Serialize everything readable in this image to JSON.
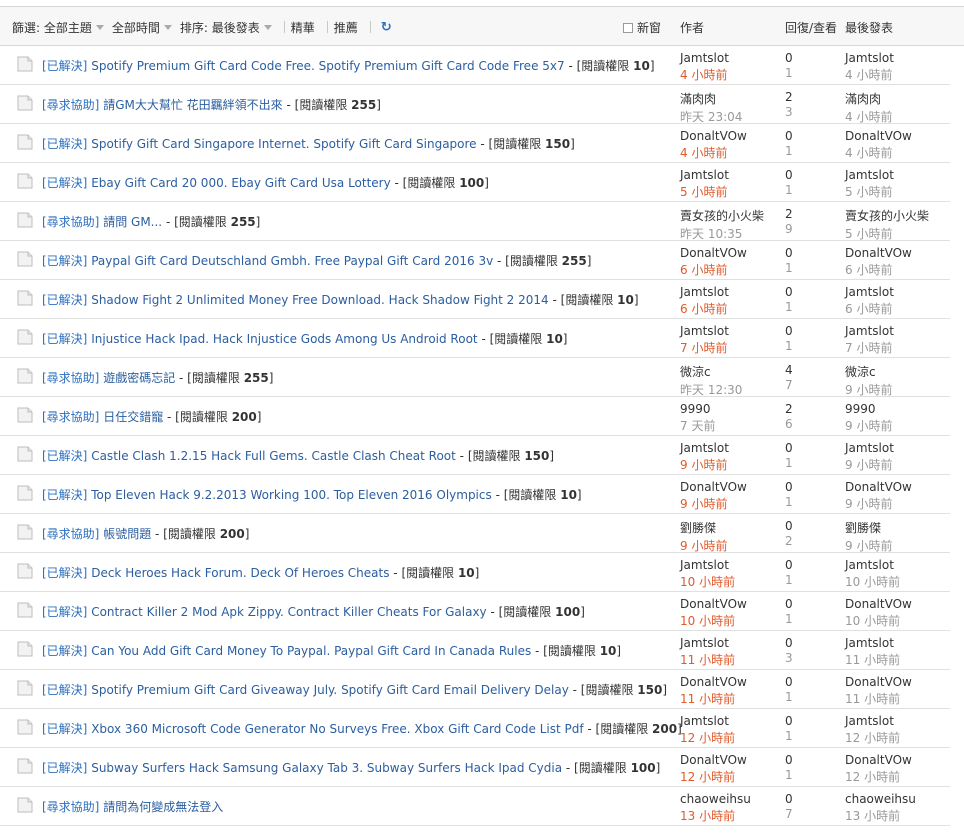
{
  "filters": {
    "topic": "篩選: 全部主題",
    "time": "全部時間",
    "sort": "排序: 最後發表",
    "digest": "精華",
    "recommend": "推薦",
    "refresh_icon": "refresh-icon"
  },
  "header": {
    "new_window": "新窗",
    "author": "作者",
    "stats": "回復/查看",
    "last_post": "最後發表"
  },
  "threads": [
    {
      "tag": "[已解決]",
      "subject": "Spotify Premium Gift Card Code Free. Spotify Premium Gift Card Code Free 5x7",
      "perm_prefix": " - [閱讀權限 ",
      "perm": "10",
      "perm_suffix": "]",
      "author": "Jamtslot",
      "author_time": "4 小時前",
      "time_style": "red",
      "replies": "0",
      "views": "1",
      "last_user": "Jamtslot",
      "last_time": "4 小時前"
    },
    {
      "tag": "[尋求協助]",
      "subject": "請GM大大幫忙 花田羈絆領不出來",
      "perm_prefix": " - [閱讀權限 ",
      "perm": "255",
      "perm_suffix": "]",
      "author": "滿肉肉",
      "author_time": "昨天 23:04",
      "time_style": "gray",
      "replies": "2",
      "views": "3",
      "last_user": "滿肉肉",
      "last_time": "4 小時前"
    },
    {
      "tag": "[已解決]",
      "subject": "Spotify Gift Card Singapore Internet. Spotify Gift Card Singapore",
      "perm_prefix": " - [閱讀權限 ",
      "perm": "150",
      "perm_suffix": "]",
      "author": "DonaltVOw",
      "author_time": "4 小時前",
      "time_style": "red",
      "replies": "0",
      "views": "1",
      "last_user": "DonaltVOw",
      "last_time": "4 小時前"
    },
    {
      "tag": "[已解決]",
      "subject": "Ebay Gift Card 20 000. Ebay Gift Card Usa Lottery",
      "perm_prefix": " - [閱讀權限 ",
      "perm": "100",
      "perm_suffix": "]",
      "author": "Jamtslot",
      "author_time": "5 小時前",
      "time_style": "red",
      "replies": "0",
      "views": "1",
      "last_user": "Jamtslot",
      "last_time": "5 小時前"
    },
    {
      "tag": "[尋求協助]",
      "subject": "請問 GM...",
      "perm_prefix": " - [閱讀權限 ",
      "perm": "255",
      "perm_suffix": "]",
      "author": "賣女孩的小火柴",
      "author_time": "昨天 10:35",
      "time_style": "gray",
      "replies": "2",
      "views": "9",
      "last_user": "賣女孩的小火柴",
      "last_time": "5 小時前"
    },
    {
      "tag": "[已解決]",
      "subject": "Paypal Gift Card Deutschland Gmbh. Free Paypal Gift Card 2016 3v",
      "perm_prefix": " - [閱讀權限 ",
      "perm": "255",
      "perm_suffix": "]",
      "author": "DonaltVOw",
      "author_time": "6 小時前",
      "time_style": "red",
      "replies": "0",
      "views": "1",
      "last_user": "DonaltVOw",
      "last_time": "6 小時前"
    },
    {
      "tag": "[已解決]",
      "subject": "Shadow Fight 2 Unlimited Money Free Download. Hack Shadow Fight 2 2014",
      "perm_prefix": " - [閱讀權限 ",
      "perm": "10",
      "perm_suffix": "]",
      "author": "Jamtslot",
      "author_time": "6 小時前",
      "time_style": "red",
      "replies": "0",
      "views": "1",
      "last_user": "Jamtslot",
      "last_time": "6 小時前"
    },
    {
      "tag": "[已解決]",
      "subject": "Injustice Hack Ipad. Hack Injustice Gods Among Us Android Root",
      "perm_prefix": " - [閱讀權限 ",
      "perm": "10",
      "perm_suffix": "]",
      "author": "Jamtslot",
      "author_time": "7 小時前",
      "time_style": "red",
      "replies": "0",
      "views": "1",
      "last_user": "Jamtslot",
      "last_time": "7 小時前"
    },
    {
      "tag": "[尋求協助]",
      "subject": "遊戲密碼忘記",
      "perm_prefix": " - [閱讀權限 ",
      "perm": "255",
      "perm_suffix": "]",
      "author": "微涼c",
      "author_time": "昨天 12:30",
      "time_style": "gray",
      "replies": "4",
      "views": "7",
      "last_user": "微涼c",
      "last_time": "9 小時前"
    },
    {
      "tag": "[尋求協助]",
      "subject": "日任交錯寵",
      "perm_prefix": " - [閱讀權限 ",
      "perm": "200",
      "perm_suffix": "]",
      "author": "9990",
      "author_time": "7 天前",
      "time_style": "gray",
      "replies": "2",
      "views": "6",
      "last_user": "9990",
      "last_time": "9 小時前"
    },
    {
      "tag": "[已解決]",
      "subject": "Castle Clash 1.2.15 Hack Full Gems. Castle Clash Cheat Root",
      "perm_prefix": " - [閱讀權限 ",
      "perm": "150",
      "perm_suffix": "]",
      "author": "Jamtslot",
      "author_time": "9 小時前",
      "time_style": "red",
      "replies": "0",
      "views": "1",
      "last_user": "Jamtslot",
      "last_time": "9 小時前"
    },
    {
      "tag": "[已解決]",
      "subject": "Top Eleven Hack 9.2.2013 Working 100. Top Eleven 2016 Olympics",
      "perm_prefix": " - [閱讀權限 ",
      "perm": "10",
      "perm_suffix": "]",
      "author": "DonaltVOw",
      "author_time": "9 小時前",
      "time_style": "red",
      "replies": "0",
      "views": "1",
      "last_user": "DonaltVOw",
      "last_time": "9 小時前"
    },
    {
      "tag": "[尋求協助]",
      "subject": "帳號問題",
      "perm_prefix": " - [閱讀權限 ",
      "perm": "200",
      "perm_suffix": "]",
      "author": "劉勝傑",
      "author_time": "9 小時前",
      "time_style": "red",
      "replies": "0",
      "views": "2",
      "last_user": "劉勝傑",
      "last_time": "9 小時前"
    },
    {
      "tag": "[已解決]",
      "subject": "Deck Heroes Hack Forum. Deck Of Heroes Cheats",
      "perm_prefix": " - [閱讀權限 ",
      "perm": "10",
      "perm_suffix": "]",
      "author": "Jamtslot",
      "author_time": "10 小時前",
      "time_style": "red",
      "replies": "0",
      "views": "1",
      "last_user": "Jamtslot",
      "last_time": "10 小時前"
    },
    {
      "tag": "[已解決]",
      "subject": "Contract Killer 2 Mod Apk Zippy. Contract Killer Cheats For Galaxy",
      "perm_prefix": " - [閱讀權限 ",
      "perm": "100",
      "perm_suffix": "]",
      "author": "DonaltVOw",
      "author_time": "10 小時前",
      "time_style": "red",
      "replies": "0",
      "views": "1",
      "last_user": "DonaltVOw",
      "last_time": "10 小時前"
    },
    {
      "tag": "[已解決]",
      "subject": "Can You Add Gift Card Money To Paypal. Paypal Gift Card In Canada Rules",
      "perm_prefix": " - [閱讀權限 ",
      "perm": "10",
      "perm_suffix": "]",
      "author": "Jamtslot",
      "author_time": "11 小時前",
      "time_style": "red",
      "replies": "0",
      "views": "3",
      "last_user": "Jamtslot",
      "last_time": "11 小時前"
    },
    {
      "tag": "[已解決]",
      "subject": "Spotify Premium Gift Card Giveaway July. Spotify Gift Card Email Delivery Delay",
      "perm_prefix": " - [閱讀權限 ",
      "perm": "150",
      "perm_suffix": "]",
      "author": "DonaltVOw",
      "author_time": "11 小時前",
      "time_style": "red",
      "replies": "0",
      "views": "1",
      "last_user": "DonaltVOw",
      "last_time": "11 小時前"
    },
    {
      "tag": "[已解決]",
      "subject": "Xbox 360 Microsoft Code Generator No Surveys Free. Xbox Gift Card Code List Pdf",
      "perm_prefix": " - [閱讀權限 ",
      "perm": "200",
      "perm_suffix": "]",
      "author": "Jamtslot",
      "author_time": "12 小時前",
      "time_style": "red",
      "replies": "0",
      "views": "1",
      "last_user": "Jamtslot",
      "last_time": "12 小時前"
    },
    {
      "tag": "[已解決]",
      "subject": "Subway Surfers Hack Samsung Galaxy Tab 3. Subway Surfers Hack Ipad Cydia",
      "perm_prefix": " - [閱讀權限 ",
      "perm": "100",
      "perm_suffix": "]",
      "author": "DonaltVOw",
      "author_time": "12 小時前",
      "time_style": "red",
      "replies": "0",
      "views": "1",
      "last_user": "DonaltVOw",
      "last_time": "12 小時前"
    },
    {
      "tag": "[尋求協助]",
      "subject": "請問為何變成無法登入",
      "perm_prefix": "",
      "perm": "",
      "perm_suffix": "",
      "author": "chaoweihsu",
      "author_time": "13 小時前",
      "time_style": "red",
      "replies": "0",
      "views": "7",
      "last_user": "chaoweihsu",
      "last_time": "13 小時前"
    }
  ],
  "colors": {
    "tag": "#2b6fbf",
    "subject": "#2b5ea0",
    "recent_time": "#e05a2a",
    "muted": "#999999"
  }
}
